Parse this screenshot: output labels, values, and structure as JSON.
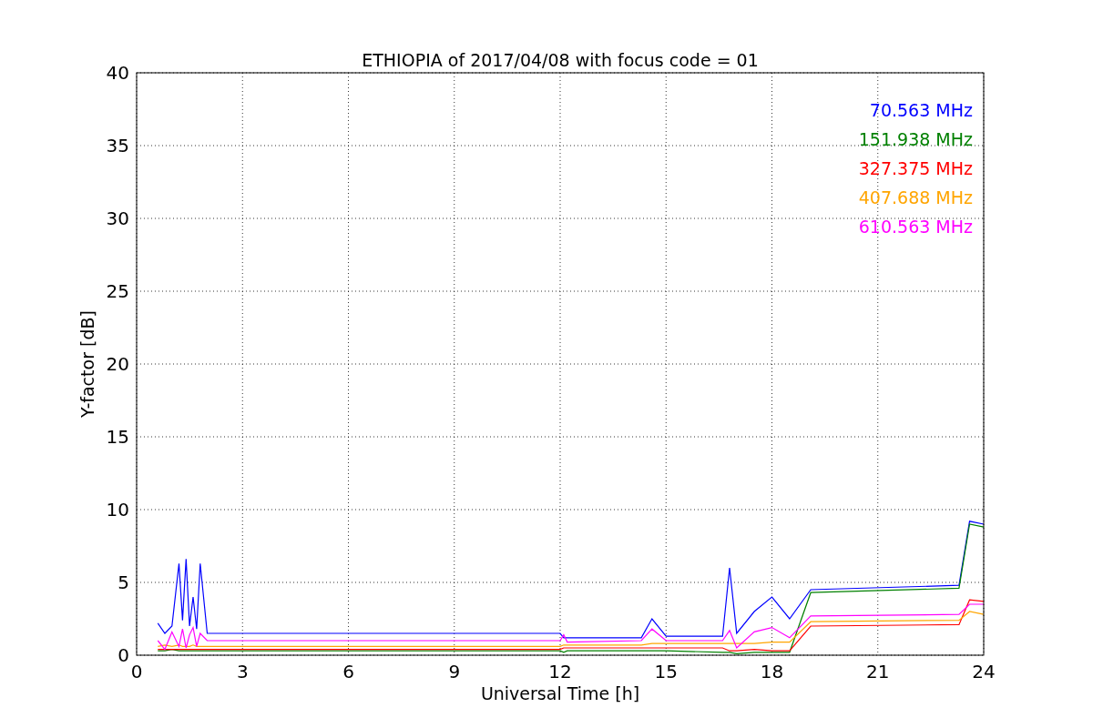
{
  "chart_data": {
    "type": "line",
    "title": "ETHIOPIA of 2017/04/08 with focus code = 01",
    "xlabel": "Universal Time [h]",
    "ylabel": "Y-factor [dB]",
    "x": [
      0.6,
      0.8,
      1.0,
      1.2,
      1.3,
      1.4,
      1.5,
      1.6,
      1.7,
      1.8,
      2.0,
      12.0,
      12.1,
      12.2,
      14.3,
      14.6,
      15.0,
      16.6,
      16.8,
      17.0,
      17.5,
      18.0,
      18.5,
      19.1,
      23.3,
      23.6,
      24.0
    ],
    "series": [
      {
        "name": "70.563 MHz",
        "color": "#0000ff",
        "values": [
          2.2,
          1.5,
          2.0,
          6.3,
          2.4,
          6.6,
          2.0,
          4.0,
          1.8,
          6.3,
          1.5,
          1.5,
          1.2,
          1.2,
          1.2,
          2.5,
          1.3,
          1.3,
          6.0,
          1.5,
          3.0,
          4.0,
          2.5,
          4.5,
          4.8,
          9.2,
          9.0
        ]
      },
      {
        "name": "151.938 MHz",
        "color": "#008000",
        "values": [
          0.3,
          0.3,
          0.4,
          0.3,
          0.3,
          0.3,
          0.3,
          0.3,
          0.3,
          0.3,
          0.3,
          0.3,
          0.2,
          0.3,
          0.3,
          0.3,
          0.3,
          0.2,
          0.2,
          0.1,
          0.2,
          0.2,
          0.2,
          4.3,
          4.6,
          9.0,
          8.8
        ]
      },
      {
        "name": "327.375 MHz",
        "color": "#ff0000",
        "values": [
          0.4,
          0.4,
          0.4,
          0.4,
          0.4,
          0.4,
          0.4,
          0.4,
          0.4,
          0.4,
          0.4,
          0.4,
          0.5,
          0.5,
          0.5,
          0.5,
          0.5,
          0.5,
          0.3,
          0.3,
          0.4,
          0.3,
          0.3,
          2.0,
          2.1,
          3.8,
          3.7
        ]
      },
      {
        "name": "407.688 MHz",
        "color": "#ffa500",
        "values": [
          0.6,
          0.7,
          0.6,
          0.7,
          0.6,
          0.6,
          0.6,
          0.7,
          0.6,
          0.6,
          0.6,
          0.6,
          0.7,
          0.7,
          0.7,
          0.8,
          0.8,
          0.8,
          0.8,
          0.8,
          0.8,
          0.9,
          0.9,
          2.3,
          2.4,
          3.0,
          2.8
        ]
      },
      {
        "name": "610.563 MHz",
        "color": "#ff00ff",
        "values": [
          1.0,
          0.4,
          1.6,
          0.6,
          1.8,
          0.5,
          1.4,
          1.9,
          0.6,
          1.5,
          1.0,
          1.0,
          1.4,
          0.9,
          1.0,
          1.8,
          1.0,
          1.0,
          1.7,
          0.5,
          1.6,
          1.9,
          1.2,
          2.7,
          2.8,
          3.5,
          3.5
        ]
      }
    ],
    "xlim": [
      0,
      24
    ],
    "ylim": [
      0,
      40
    ],
    "xticks": [
      0,
      3,
      6,
      9,
      12,
      15,
      18,
      21,
      24
    ],
    "yticks": [
      0,
      5,
      10,
      15,
      20,
      25,
      30,
      35,
      40
    ],
    "grid": true
  }
}
